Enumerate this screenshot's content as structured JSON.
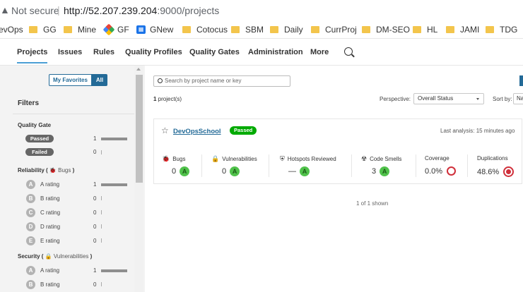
{
  "browser": {
    "security_label": "Not secure",
    "url_host": "http://52.207.239.204",
    "url_path": ":9000/projects"
  },
  "bookmarks": [
    "evOps",
    "GG",
    "Mine",
    "GF",
    "GNew",
    "Cotocus",
    "SBM",
    "Daily",
    "CurrProj",
    "DM-SEO",
    "HL",
    "JAMI",
    "TDG"
  ],
  "nav": {
    "items": [
      "Projects",
      "Issues",
      "Rules",
      "Quality Profiles",
      "Quality Gates",
      "Administration",
      "More"
    ],
    "active": "Projects"
  },
  "sidebar": {
    "favorites_label": "My Favorites",
    "all_label": "All",
    "filters_title": "Filters",
    "quality_gate": {
      "title": "Quality Gate",
      "options": [
        {
          "label": "Passed",
          "count": "1",
          "fill": 1.0
        },
        {
          "label": "Failed",
          "count": "0",
          "fill": 0
        }
      ]
    },
    "reliability": {
      "title": "Reliability",
      "sub": "Bugs",
      "ratings": [
        {
          "letter": "A",
          "label": "A rating",
          "count": "1",
          "fill": 1.0
        },
        {
          "letter": "B",
          "label": "B rating",
          "count": "0",
          "fill": 0
        },
        {
          "letter": "C",
          "label": "C rating",
          "count": "0",
          "fill": 0
        },
        {
          "letter": "D",
          "label": "D rating",
          "count": "0",
          "fill": 0
        },
        {
          "letter": "E",
          "label": "E rating",
          "count": "0",
          "fill": 0
        }
      ]
    },
    "security": {
      "title": "Security",
      "sub": "Vulnerabilities",
      "ratings": [
        {
          "letter": "A",
          "label": "A rating",
          "count": "1",
          "fill": 1.0
        },
        {
          "letter": "B",
          "label": "B rating",
          "count": "0",
          "fill": 0
        }
      ]
    }
  },
  "main": {
    "search_placeholder": "Search by project name or key",
    "project_count_num": "1",
    "project_count_suffix": " project(s)",
    "perspective_label": "Perspective:",
    "perspective_value": "Overall Status",
    "sort_label": "Sort by:",
    "sort_value": "Na",
    "footer": "1 of 1 shown"
  },
  "project": {
    "name": "DevOpsSchool",
    "quality_gate": "Passed",
    "last_analysis": "Last analysis: 15 minutes ago",
    "metrics": {
      "bugs": {
        "label": "Bugs",
        "value": "0",
        "rating": "A"
      },
      "vulnerabilities": {
        "label": "Vulnerabilities",
        "value": "0",
        "rating": "A"
      },
      "hotspots": {
        "label": "Hotspots Reviewed",
        "value": "—",
        "rating": "A"
      },
      "code_smells": {
        "label": "Code Smells",
        "value": "3",
        "rating": "A"
      },
      "coverage": {
        "label": "Coverage",
        "value": "0.0%"
      },
      "duplications": {
        "label": "Duplications",
        "value": "48.6%"
      }
    }
  },
  "colors": {
    "accent": "#236a97",
    "passed": "#00aa00",
    "rating_a": "#50c24b",
    "danger": "#d02f3a"
  }
}
